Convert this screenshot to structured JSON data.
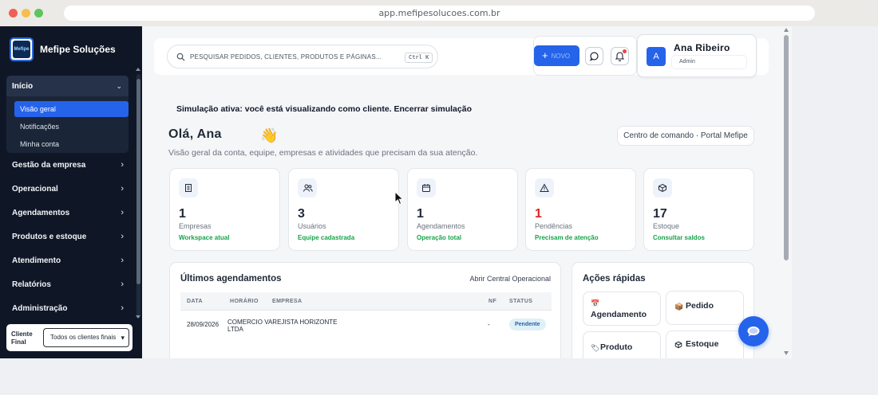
{
  "browser": {
    "url": "app.mefipesolucoes.com.br"
  },
  "sidebar": {
    "brand": "Mefipe Soluções",
    "logo_text": "Mefipe",
    "open_section": {
      "label": "Início"
    },
    "sub_items": [
      {
        "label": "Visão geral",
        "active": true
      },
      {
        "label": "Notificações"
      },
      {
        "label": "Minha conta"
      }
    ],
    "items": [
      {
        "label": "Gestão da empresa"
      },
      {
        "label": "Operacional"
      },
      {
        "label": "Agendamentos"
      },
      {
        "label": "Produtos e estoque"
      },
      {
        "label": "Atendimento"
      },
      {
        "label": "Relatórios"
      },
      {
        "label": "Administração"
      }
    ],
    "client": {
      "label": "Cliente Final",
      "selected": "Todos os clientes finais"
    }
  },
  "topbar": {
    "search_placeholder": "PESQUISAR PEDIDOS, CLIENTES, PRODUTOS E PÁGINAS...",
    "shortcut": "Ctrl K",
    "new_label": "NOVO",
    "user": {
      "initial": "A",
      "name": "Ana Ribeiro",
      "role": "Admin"
    }
  },
  "page": {
    "simulation_notice": "Simulação ativa: você está visualizando como cliente. Encerrar simulação",
    "greeting": "Olá, Ana",
    "subtitle": "Visão geral da conta, equipe, empresas e atividades que precisam da sua atenção.",
    "command_center": "Centro de comando · Portal Mefipe"
  },
  "stats": [
    {
      "value": "1",
      "label": "Empresas",
      "sub": "Workspace atual",
      "icon": "building-icon"
    },
    {
      "value": "3",
      "label": "Usuários",
      "sub": "Equipe cadastrada",
      "icon": "users-icon"
    },
    {
      "value": "1",
      "label": "Agendamentos",
      "sub": "Operação total",
      "icon": "calendar-icon"
    },
    {
      "value": "1",
      "label": "Pendências",
      "sub": "Precisam de atenção",
      "icon": "warning-icon"
    },
    {
      "value": "17",
      "label": "Estoque",
      "sub": "Consultar saldos",
      "icon": "box-icon"
    }
  ],
  "schedule": {
    "title": "Últimos agendamentos",
    "link": "Abrir Central Operacional",
    "columns": [
      "DATA",
      "HORÁRIO",
      "EMPRESA",
      "NF",
      "STATUS"
    ],
    "rows": [
      {
        "date": "28/09/2026",
        "time": "",
        "company_line1": "COMERCIO VAREJISTA HORIZONTE",
        "company_line2": "LTDA",
        "nf": "-",
        "status": "Pendente"
      }
    ]
  },
  "quick_actions": {
    "title": "Ações rápidas",
    "items": [
      {
        "label": "Agendamento",
        "icon": "calendar-icon"
      },
      {
        "label": "Pedido",
        "icon": "package-icon"
      },
      {
        "label": "Produto",
        "icon": "tag-icon"
      },
      {
        "label": "Estoque",
        "icon": "box-icon"
      }
    ]
  },
  "colors": {
    "accent": "#2563eb",
    "sidebar": "#0f1727",
    "success": "#16a34a",
    "danger": "#dc2626"
  }
}
